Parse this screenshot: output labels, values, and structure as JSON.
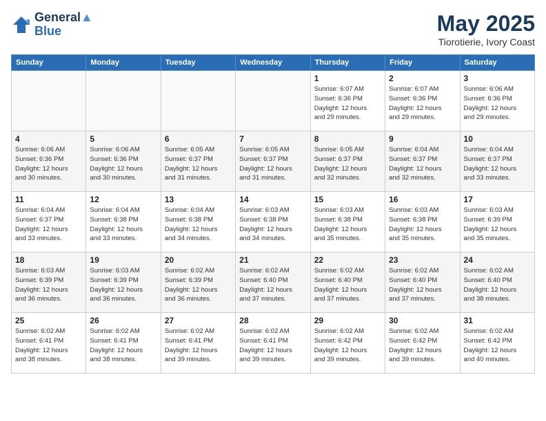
{
  "logo": {
    "line1": "General",
    "line2": "Blue"
  },
  "title": "May 2025",
  "location": "Tiorotierie, Ivory Coast",
  "days_of_week": [
    "Sunday",
    "Monday",
    "Tuesday",
    "Wednesday",
    "Thursday",
    "Friday",
    "Saturday"
  ],
  "weeks": [
    [
      {
        "day": "",
        "info": ""
      },
      {
        "day": "",
        "info": ""
      },
      {
        "day": "",
        "info": ""
      },
      {
        "day": "",
        "info": ""
      },
      {
        "day": "1",
        "info": "Sunrise: 6:07 AM\nSunset: 6:36 PM\nDaylight: 12 hours\nand 29 minutes."
      },
      {
        "day": "2",
        "info": "Sunrise: 6:07 AM\nSunset: 6:36 PM\nDaylight: 12 hours\nand 29 minutes."
      },
      {
        "day": "3",
        "info": "Sunrise: 6:06 AM\nSunset: 6:36 PM\nDaylight: 12 hours\nand 29 minutes."
      }
    ],
    [
      {
        "day": "4",
        "info": "Sunrise: 6:06 AM\nSunset: 6:36 PM\nDaylight: 12 hours\nand 30 minutes."
      },
      {
        "day": "5",
        "info": "Sunrise: 6:06 AM\nSunset: 6:36 PM\nDaylight: 12 hours\nand 30 minutes."
      },
      {
        "day": "6",
        "info": "Sunrise: 6:05 AM\nSunset: 6:37 PM\nDaylight: 12 hours\nand 31 minutes."
      },
      {
        "day": "7",
        "info": "Sunrise: 6:05 AM\nSunset: 6:37 PM\nDaylight: 12 hours\nand 31 minutes."
      },
      {
        "day": "8",
        "info": "Sunrise: 6:05 AM\nSunset: 6:37 PM\nDaylight: 12 hours\nand 32 minutes."
      },
      {
        "day": "9",
        "info": "Sunrise: 6:04 AM\nSunset: 6:37 PM\nDaylight: 12 hours\nand 32 minutes."
      },
      {
        "day": "10",
        "info": "Sunrise: 6:04 AM\nSunset: 6:37 PM\nDaylight: 12 hours\nand 33 minutes."
      }
    ],
    [
      {
        "day": "11",
        "info": "Sunrise: 6:04 AM\nSunset: 6:37 PM\nDaylight: 12 hours\nand 33 minutes."
      },
      {
        "day": "12",
        "info": "Sunrise: 6:04 AM\nSunset: 6:38 PM\nDaylight: 12 hours\nand 33 minutes."
      },
      {
        "day": "13",
        "info": "Sunrise: 6:04 AM\nSunset: 6:38 PM\nDaylight: 12 hours\nand 34 minutes."
      },
      {
        "day": "14",
        "info": "Sunrise: 6:03 AM\nSunset: 6:38 PM\nDaylight: 12 hours\nand 34 minutes."
      },
      {
        "day": "15",
        "info": "Sunrise: 6:03 AM\nSunset: 6:38 PM\nDaylight: 12 hours\nand 35 minutes."
      },
      {
        "day": "16",
        "info": "Sunrise: 6:03 AM\nSunset: 6:38 PM\nDaylight: 12 hours\nand 35 minutes."
      },
      {
        "day": "17",
        "info": "Sunrise: 6:03 AM\nSunset: 6:39 PM\nDaylight: 12 hours\nand 35 minutes."
      }
    ],
    [
      {
        "day": "18",
        "info": "Sunrise: 6:03 AM\nSunset: 6:39 PM\nDaylight: 12 hours\nand 36 minutes."
      },
      {
        "day": "19",
        "info": "Sunrise: 6:03 AM\nSunset: 6:39 PM\nDaylight: 12 hours\nand 36 minutes."
      },
      {
        "day": "20",
        "info": "Sunrise: 6:02 AM\nSunset: 6:39 PM\nDaylight: 12 hours\nand 36 minutes."
      },
      {
        "day": "21",
        "info": "Sunrise: 6:02 AM\nSunset: 6:40 PM\nDaylight: 12 hours\nand 37 minutes."
      },
      {
        "day": "22",
        "info": "Sunrise: 6:02 AM\nSunset: 6:40 PM\nDaylight: 12 hours\nand 37 minutes."
      },
      {
        "day": "23",
        "info": "Sunrise: 6:02 AM\nSunset: 6:40 PM\nDaylight: 12 hours\nand 37 minutes."
      },
      {
        "day": "24",
        "info": "Sunrise: 6:02 AM\nSunset: 6:40 PM\nDaylight: 12 hours\nand 38 minutes."
      }
    ],
    [
      {
        "day": "25",
        "info": "Sunrise: 6:02 AM\nSunset: 6:41 PM\nDaylight: 12 hours\nand 38 minutes."
      },
      {
        "day": "26",
        "info": "Sunrise: 6:02 AM\nSunset: 6:41 PM\nDaylight: 12 hours\nand 38 minutes."
      },
      {
        "day": "27",
        "info": "Sunrise: 6:02 AM\nSunset: 6:41 PM\nDaylight: 12 hours\nand 39 minutes."
      },
      {
        "day": "28",
        "info": "Sunrise: 6:02 AM\nSunset: 6:41 PM\nDaylight: 12 hours\nand 39 minutes."
      },
      {
        "day": "29",
        "info": "Sunrise: 6:02 AM\nSunset: 6:42 PM\nDaylight: 12 hours\nand 39 minutes."
      },
      {
        "day": "30",
        "info": "Sunrise: 6:02 AM\nSunset: 6:42 PM\nDaylight: 12 hours\nand 39 minutes."
      },
      {
        "day": "31",
        "info": "Sunrise: 6:02 AM\nSunset: 6:42 PM\nDaylight: 12 hours\nand 40 minutes."
      }
    ]
  ]
}
